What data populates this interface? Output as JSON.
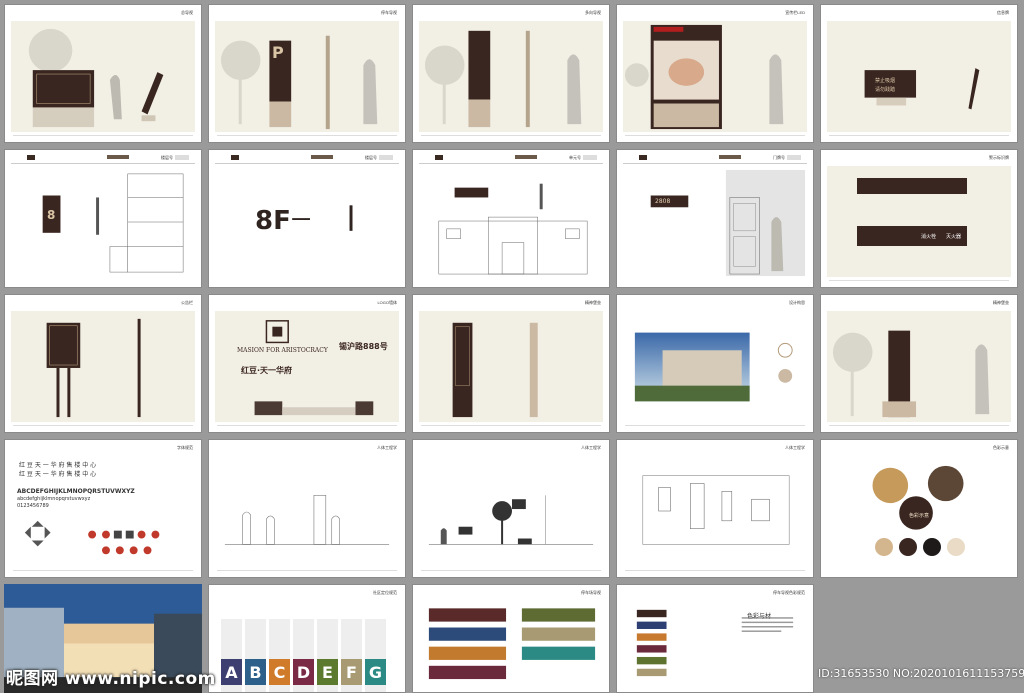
{
  "pages": [
    {
      "title": "总导视"
    },
    {
      "title": "停车导视"
    },
    {
      "title": "多向导视"
    },
    {
      "title": "宣传栏LED"
    },
    {
      "title": "信息牌"
    },
    {
      "title": "楼层号"
    },
    {
      "title": "楼层号"
    },
    {
      "title": "单元号"
    },
    {
      "title": "门牌号"
    },
    {
      "title": "警示标识牌"
    },
    {
      "title": "公告栏"
    },
    {
      "title": "LOGO墙体"
    },
    {
      "title": "精神堡垒"
    },
    {
      "title": "设计构思"
    },
    {
      "title": "精神堡垒"
    },
    {
      "title": "字体规范"
    },
    {
      "title": "人体工程学"
    },
    {
      "title": "人体工程学"
    },
    {
      "title": "人体工程学"
    },
    {
      "title": "色彩示意"
    },
    {
      "title": ""
    },
    {
      "title": "社区定位规范"
    },
    {
      "title": "停车场导视"
    },
    {
      "title": "停车导视色彩规范"
    }
  ],
  "texts": {
    "p_letter": "P",
    "floor_8": "8",
    "floor_8f": "8F",
    "door_number": "2808",
    "logo_en": "MASION FOR ARISTOCRACY",
    "logo_cn": "红豆·天一华府",
    "address": "锡沪路888号",
    "font_line1": "红 豆 天 一 华 府 售 楼 中 心",
    "font_line2": "红 豆 天 一 华 府 售 楼 中 心",
    "alphabet": "ABCDEFGHIJKLMNOPQRSTUVWXYZ",
    "alphabet_lower": "abcdefghijklmnopqrstuvwxyz",
    "digits": "0123456789",
    "color_title": "色彩示意",
    "palette_title": "色彩与材",
    "watermark": "昵图网 www.nipic.com",
    "id_text": "ID:31653530 NO:20201016111537590085",
    "fire_1": "消火栓",
    "fire_2": "灭火器",
    "sign_top": "禁止吸烟",
    "sign_top2": "请勿践踏"
  },
  "letters": [
    {
      "char": "A",
      "color": "#3d3f70"
    },
    {
      "char": "B",
      "color": "#2c5f8a"
    },
    {
      "char": "C",
      "color": "#d07b2a"
    },
    {
      "char": "D",
      "color": "#7a2a44"
    },
    {
      "char": "E",
      "color": "#5b7a2e"
    },
    {
      "char": "F",
      "color": "#a89a73"
    },
    {
      "char": "G",
      "color": "#2b8b84"
    }
  ],
  "swatch_colors": [
    "#d4b68e",
    "#3a2620",
    "#1e1a1a",
    "#e9dbc5"
  ],
  "palette_colors": [
    "#3a2620",
    "#2d3f73",
    "#c77a2e",
    "#6b2a3b",
    "#5e7330",
    "#a89a73",
    "#2b8b84"
  ],
  "parking_colors": [
    "#5a2a2a",
    "#5e6b33",
    "#2c4a7a",
    "#a89a73",
    "#c27a2e",
    "#2b8b84",
    "#6b2a3b"
  ],
  "icons": [
    "arrow-icon",
    "no-smoking-icon",
    "parking-icon",
    "wheelchair-icon",
    "no-entry-icon"
  ]
}
